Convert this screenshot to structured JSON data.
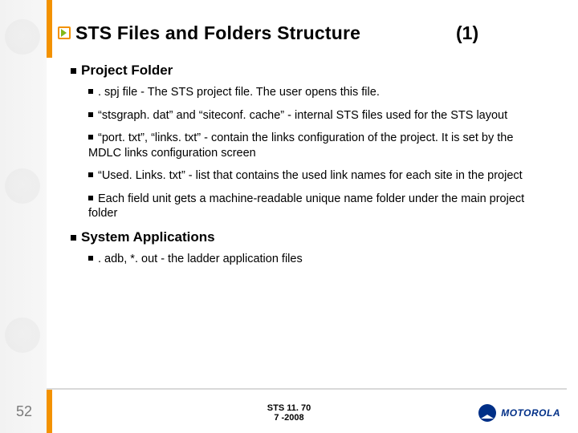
{
  "title": "STS Files and Folders Structure",
  "title_number": "(1)",
  "sections": [
    {
      "heading": "Project Folder",
      "items": [
        ". spj file - The STS project file. The user opens this file.",
        "“stsgraph. dat” and “siteconf. cache”  - internal STS files used for the STS layout",
        "“port. txt”,  “links. txt” - contain the links configuration of the project. It is set by the MDLC links configuration screen",
        "“Used. Links. txt” - list that contains the used link names for each site in the project",
        "Each field unit gets a machine-readable unique name folder under the main project folder"
      ]
    },
    {
      "heading": "System Applications",
      "items": [
        ". adb, *. out - the ladder application files"
      ]
    }
  ],
  "page_number": "52",
  "footer_line1": "STS 11. 70",
  "footer_line2": "7 -2008",
  "brand": "MOTOROLA"
}
